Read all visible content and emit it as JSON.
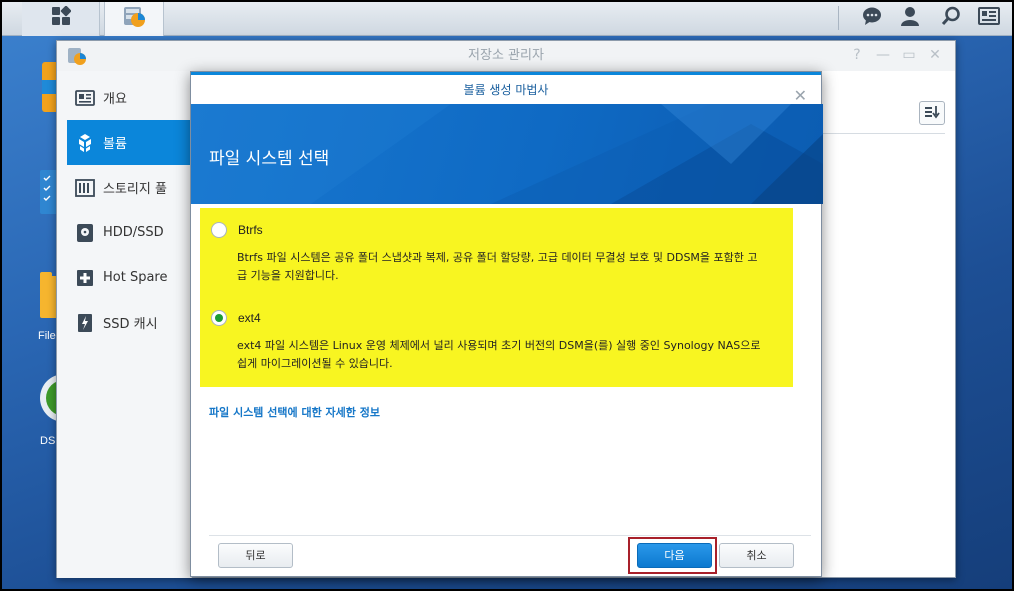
{
  "window": {
    "title": "저장소 관리자"
  },
  "sidebar": {
    "items": [
      {
        "label": "개요",
        "icon": "overview-icon",
        "active": false
      },
      {
        "label": "볼륨",
        "icon": "volume-icon",
        "active": true
      },
      {
        "label": "스토리지 풀",
        "icon": "storage-pool-icon",
        "active": false
      },
      {
        "label": "HDD/SSD",
        "icon": "hdd-icon",
        "active": false
      },
      {
        "label": "Hot Spare",
        "icon": "hot-spare-icon",
        "active": false
      },
      {
        "label": "SSD 캐시",
        "icon": "ssd-cache-icon",
        "active": false
      }
    ]
  },
  "desktop": {
    "labels": [
      "File",
      "DS"
    ]
  },
  "wizard": {
    "title": "볼륨 생성 마법사",
    "heading": "파일 시스템 선택",
    "options": [
      {
        "label": "Btrfs",
        "checked": false,
        "description_line1": "Btrfs 파일 시스템은 공유 폴더 스냅샷과 복제, 공유 폴더 할당량, 고급 데이터 무결성 보호 및 DDSM을 포함한 고",
        "description_line2": "급 기능을 지원합니다."
      },
      {
        "label": "ext4",
        "checked": true,
        "description_line1": "ext4 파일 시스템은 Linux 운영 체제에서 널리 사용되며 초기 버전의 DSM을(를) 실행 중인 Synology NAS으로",
        "description_line2": "쉽게 마이그레이션될 수 있습니다."
      }
    ],
    "more_link": "파일 시스템 선택에 대한 자세한 정보",
    "buttons": {
      "back": "뒤로",
      "next": "다음",
      "cancel": "취소"
    }
  },
  "colors": {
    "accent": "#0b86da",
    "highlight": "#f8f521",
    "selected_radio": "#1d9c32"
  }
}
